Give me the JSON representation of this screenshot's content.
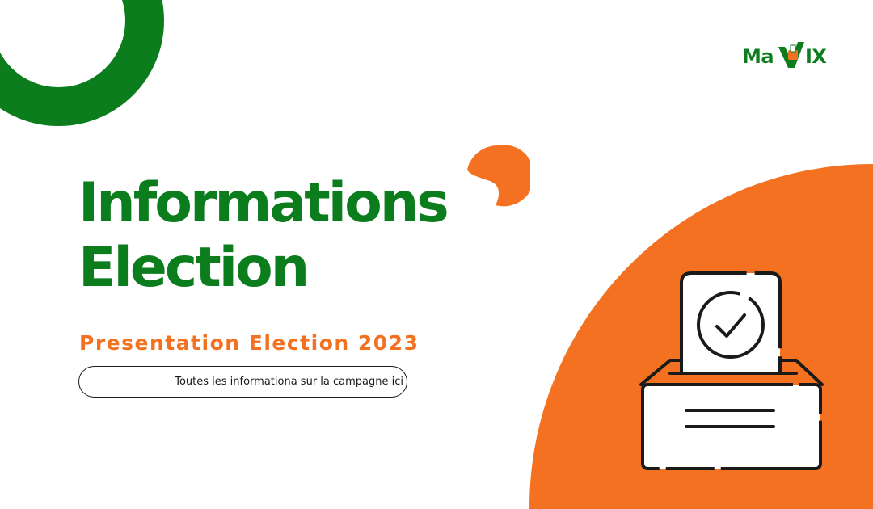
{
  "colors": {
    "brand_green": "#0b7d1d",
    "brand_orange": "#f37120",
    "background": "#ffffff"
  },
  "logo": {
    "text_left": "Ma",
    "text_right": "IX",
    "v_icon": "checkmark-ballot-v-icon"
  },
  "hero": {
    "title_line1": "Informations",
    "title_line2": "Election",
    "subtitle": "Presentation Election 2023"
  },
  "cta": {
    "label": "Toutes les informationa sur la campagne ici"
  },
  "illustration": {
    "icon": "ballot-box-icon"
  }
}
